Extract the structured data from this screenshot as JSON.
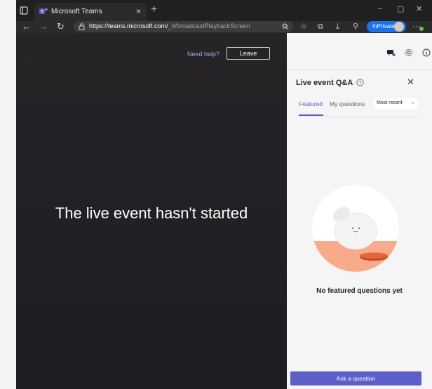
{
  "browser": {
    "tab_title": "Microsoft Teams",
    "tab_close": "×",
    "new_tab": "+",
    "window_controls": [
      "–",
      "▢",
      "✕"
    ],
    "nav": {
      "back": "←",
      "forward": "→",
      "reload": "↻"
    },
    "url_host": "https://teams.microsoft.com/",
    "url_path": "_#/broadcastPlaybackScreen",
    "inprivate_label": "InPrivate",
    "more": "···",
    "toolbar_icons": [
      "zoom-icon",
      "favorites-add-icon",
      "favorites-icon",
      "collections-icon",
      "downloads-icon",
      "extensions-icon"
    ]
  },
  "player": {
    "help_link": "Need help?",
    "leave_label": "Leave",
    "status_text": "The live event hasn't started"
  },
  "panel": {
    "toolbar_icons": [
      "chat-icon",
      "settings-icon",
      "info-icon"
    ],
    "title": "Live event Q&A",
    "close": "✕",
    "tabs": [
      {
        "label": "Featured",
        "selected": true
      },
      {
        "label": "My questions",
        "selected": false
      }
    ],
    "sort_value": "Most recent",
    "empty_message": "No featured questions yet",
    "ask_label": "Ask a question"
  },
  "colors": {
    "accent": "#5b5fc7",
    "player_bg": "#262427",
    "panel_bg": "#f5f5f5",
    "inprivate": "#1a73e8",
    "illustration_orange": "#f7ab8a"
  }
}
